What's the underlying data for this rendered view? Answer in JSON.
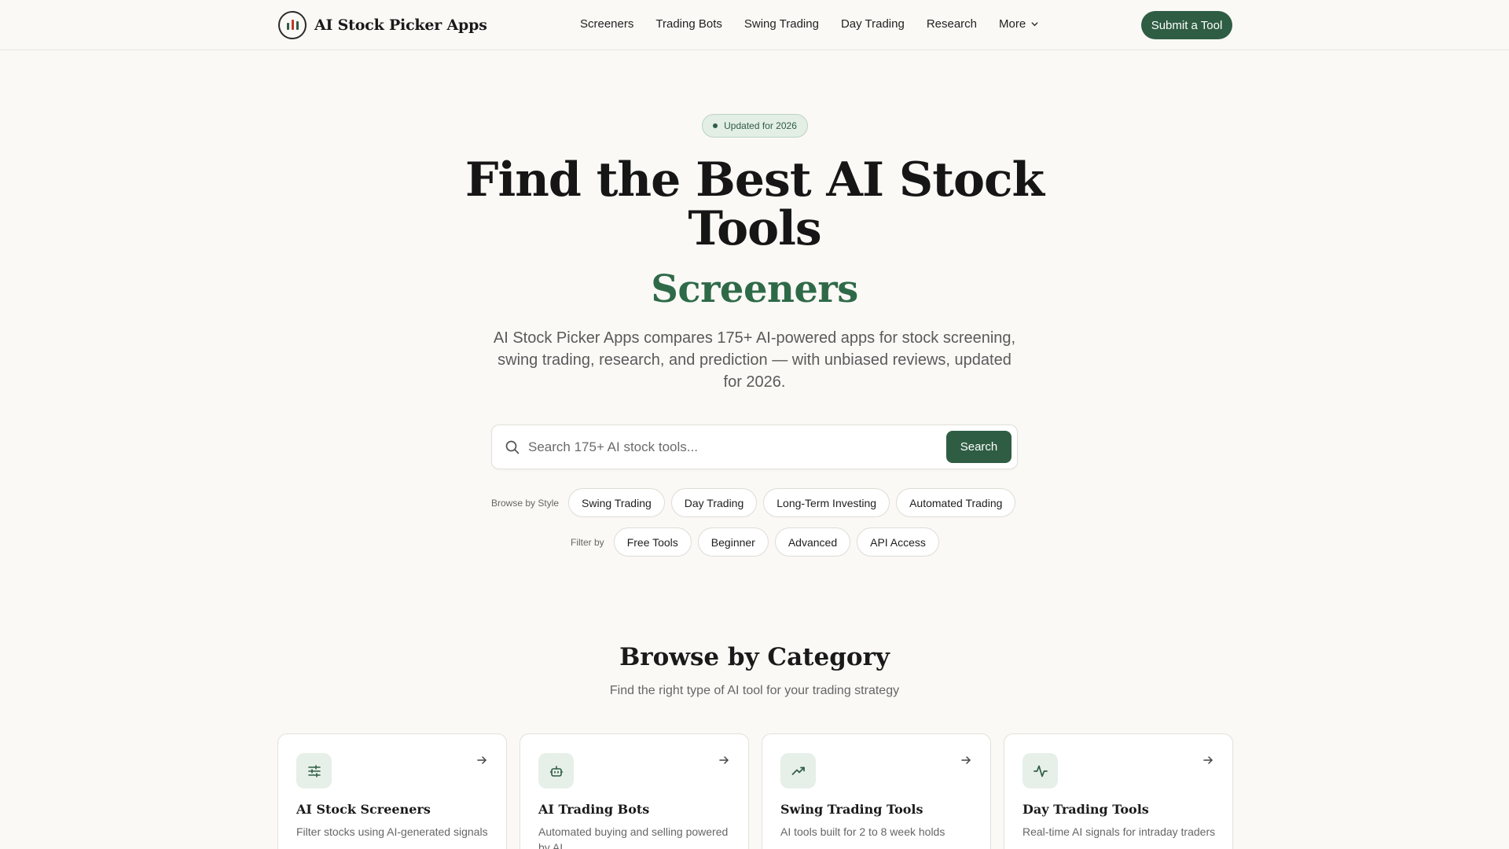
{
  "brand": {
    "name": "AI Stock Picker Apps"
  },
  "nav": {
    "links": [
      "Screeners",
      "Trading Bots",
      "Swing Trading",
      "Day Trading",
      "Research"
    ],
    "more_label": "More",
    "submit_label": "Submit a Tool"
  },
  "hero": {
    "badge": "Updated for 2026",
    "title": "Find the Best AI Stock Tools",
    "accent": "Screeners",
    "description": "AI Stock Picker Apps compares 175+ AI-powered apps for stock screening, swing trading, research, and prediction — with unbiased reviews, updated for 2026."
  },
  "search": {
    "placeholder": "Search 175+ AI stock tools...",
    "value": "",
    "button_label": "Search"
  },
  "browse_style": {
    "label": "Browse by Style",
    "chips": [
      "Swing Trading",
      "Day Trading",
      "Long-Term Investing",
      "Automated Trading"
    ]
  },
  "filter_by": {
    "label": "Filter by",
    "chips": [
      "Free Tools",
      "Beginner",
      "Advanced",
      "API Access"
    ]
  },
  "categories": {
    "title": "Browse by Category",
    "subtitle": "Find the right type of AI tool for your trading strategy",
    "cards": [
      {
        "icon": "sliders-icon",
        "title": "AI Stock Screeners",
        "desc": "Filter stocks using AI-generated signals"
      },
      {
        "icon": "robot-icon",
        "title": "AI Trading Bots",
        "desc": "Automated buying and selling powered by AI"
      },
      {
        "icon": "trending-up-icon",
        "title": "Swing Trading Tools",
        "desc": "AI tools built for 2 to 8 week holds"
      },
      {
        "icon": "activity-icon",
        "title": "Day Trading Tools",
        "desc": "Real-time AI signals for intraday traders"
      }
    ]
  },
  "colors": {
    "accent": "#2f5d43",
    "accent_text": "#2f6a48",
    "badge_bg": "#e3eee5",
    "background": "#faf9f6"
  }
}
